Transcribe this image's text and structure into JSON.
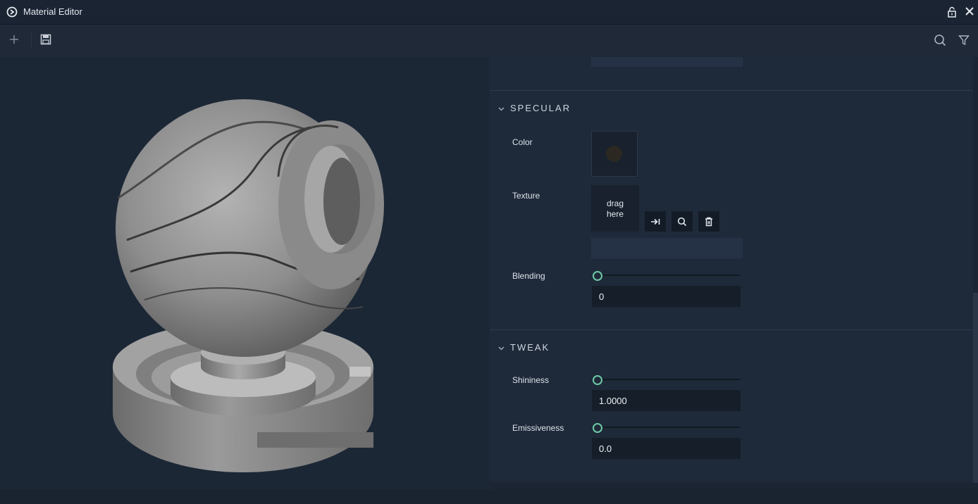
{
  "window": {
    "title": "Material Editor"
  },
  "toolbar": {
    "add_icon": "plus-icon",
    "save_icon": "save-icon",
    "search_icon": "search-icon",
    "filter_icon": "filter-icon"
  },
  "colors": {
    "accent": "#6fc7a6",
    "background": "#1e2836",
    "panel": "#1e2a3a",
    "input": "#161e29"
  },
  "specular": {
    "header": "SPECULAR",
    "color_label": "Color",
    "color_value": "#2b2822",
    "texture_label": "Texture",
    "texture_drop_line1": "drag",
    "texture_drop_line2": "here",
    "blending_label": "Blending",
    "blending_value": "0",
    "blending_fraction": 0
  },
  "tweak": {
    "header": "TWEAK",
    "shininess_label": "Shininess",
    "shininess_value": "1.0000",
    "shininess_fraction": 0,
    "emissiveness_label": "Emissiveness",
    "emissiveness_value": "0.0",
    "emissiveness_fraction": 0
  }
}
